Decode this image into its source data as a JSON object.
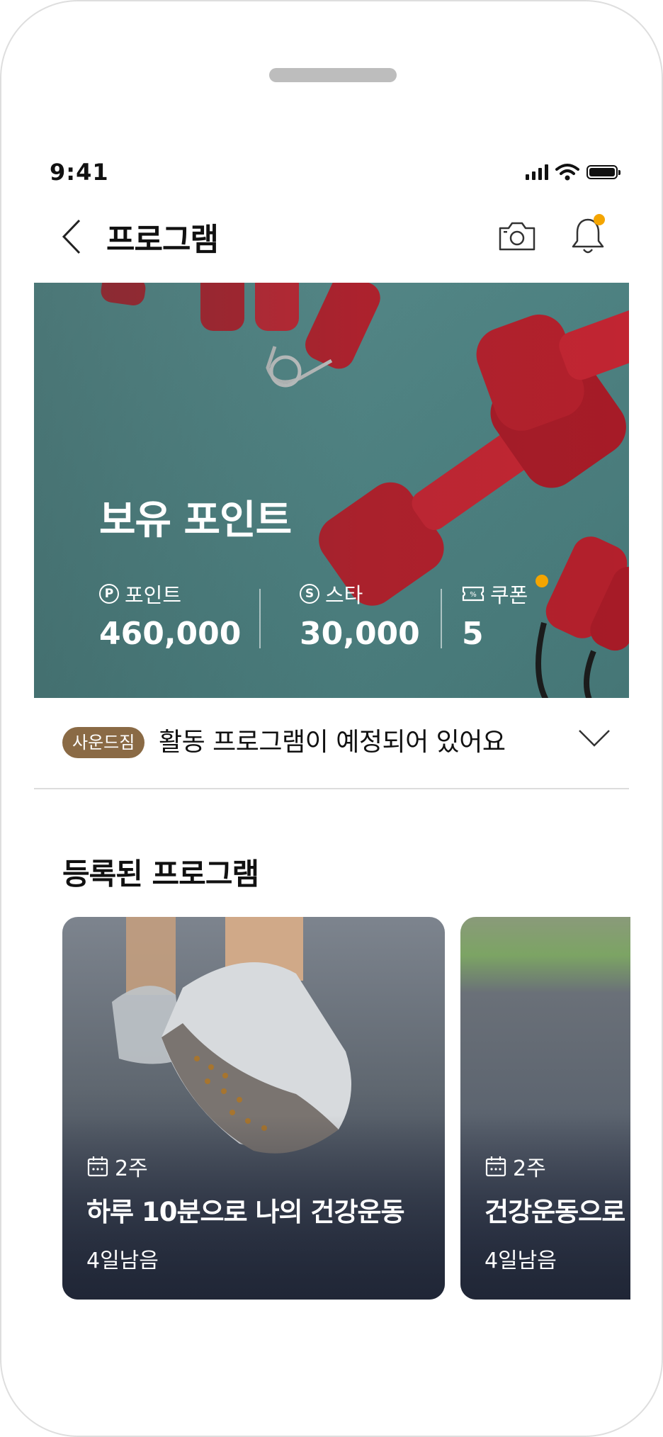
{
  "status_bar": {
    "time": "9:41"
  },
  "header": {
    "title": "프로그램"
  },
  "hero": {
    "title": "보유 포인트",
    "stats": [
      {
        "icon_text": "P",
        "label": "포인트",
        "value": "460,000"
      },
      {
        "icon_text": "S",
        "label": "스타",
        "value": "30,000"
      },
      {
        "label": "쿠폰",
        "value": "5",
        "has_new": true
      }
    ]
  },
  "notice": {
    "badge": "사운드짐",
    "text": "활동 프로그램이 예정되어 있어요"
  },
  "section": {
    "title": "등록된 프로그램"
  },
  "programs": [
    {
      "duration": "2주",
      "title": "하루 10분으로 나의 건강운동",
      "remaining": "4일남음"
    },
    {
      "duration": "2주",
      "title": "건강운동으로",
      "remaining": "4일남음"
    }
  ],
  "colors": {
    "accent_dot": "#f4a500",
    "badge": "#8a6a45",
    "hero_bg": "#4e8282"
  }
}
